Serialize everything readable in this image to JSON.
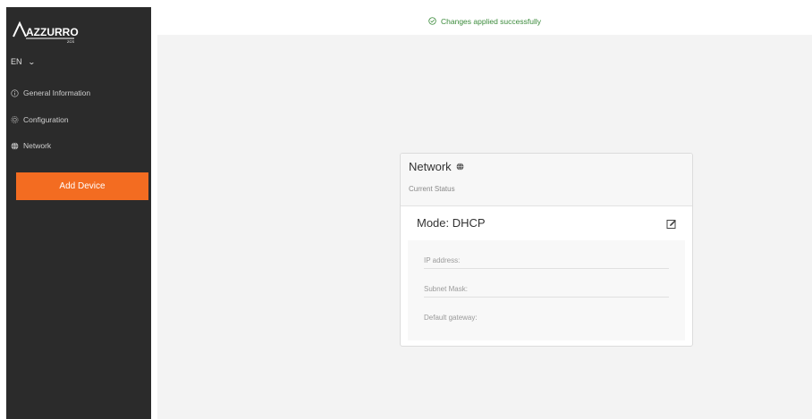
{
  "sidebar": {
    "logo_text": "AZZURRO",
    "logo_sub": "ZCS",
    "lang": "EN",
    "nav": [
      {
        "label": "General Information",
        "icon": "info-icon"
      },
      {
        "label": "Configuration",
        "icon": "gear-icon"
      },
      {
        "label": "Network",
        "icon": "globe-icon"
      }
    ],
    "add_device": "Add Device"
  },
  "banner": {
    "message": "Changes applied successfully",
    "icon": "check-circle-icon",
    "color": "#3a8a3a"
  },
  "card": {
    "title": "Network",
    "title_icon": "globe-icon",
    "subtitle": "Current Status",
    "mode": "Mode: DHCP",
    "edit_icon": "edit-icon",
    "fields": [
      {
        "label": "IP address:"
      },
      {
        "label": "Subnet Mask:"
      },
      {
        "label": "Default gateway:"
      }
    ]
  },
  "colors": {
    "accent": "#f36c21",
    "sidebar_bg": "#2b2b2b",
    "content_bg": "#f3f3f3"
  }
}
